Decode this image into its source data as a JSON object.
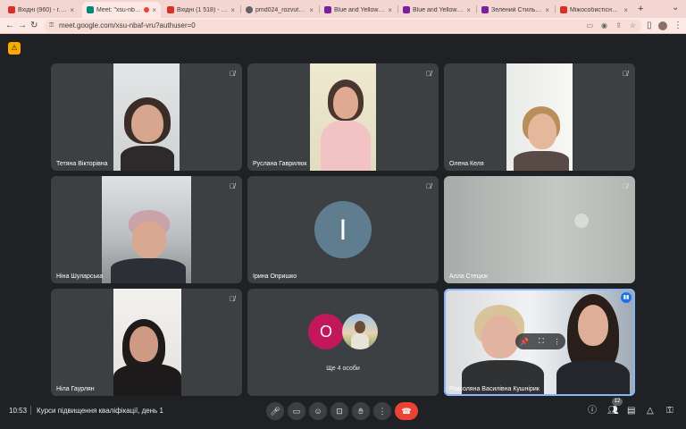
{
  "browser": {
    "tabs": [
      {
        "title": "Вхідні (960) - r.kus@",
        "favicon_color": "#d93025"
      },
      {
        "title": "Meet: \"xsu-nbaf-",
        "favicon_color": "#00897b",
        "active": true
      },
      {
        "title": "Вхідні (1 518) - rocon",
        "favicon_color": "#d93025"
      },
      {
        "title": "pmd024_rozvutok_m",
        "favicon_color": "#5f6368"
      },
      {
        "title": "Blue and Yellow Playf",
        "favicon_color": "#7b1fa2"
      },
      {
        "title": "Blue and Yellow Playf",
        "favicon_color": "#7b1fa2"
      },
      {
        "title": "Зелений Стильний",
        "favicon_color": "#7b1fa2"
      },
      {
        "title": "Міжособистісний ко",
        "favicon_color": "#d93025"
      }
    ],
    "url": "meet.google.com/xsu-nbaf-vru?authuser=0",
    "close_char": "×",
    "new_tab": "+"
  },
  "participants": [
    {
      "name": "Тетяна Вікторівна",
      "muted": true
    },
    {
      "name": "Руслана Гаврилюк",
      "muted": true
    },
    {
      "name": "Олена Келя",
      "muted": true
    },
    {
      "name": "Ніна Шуларська",
      "muted": true
    },
    {
      "name": "Ірина Опришко",
      "muted": true,
      "initial": "I"
    },
    {
      "name": "Алла Стецюк",
      "muted": true
    },
    {
      "name": "Ніла Гаурлян",
      "muted": true
    },
    {
      "name": "Роксоляна Василівна Кушнірик",
      "speaking": true
    }
  ],
  "others": {
    "label": "Ще 4 особи",
    "initial": "O"
  },
  "footer": {
    "time": "10:53",
    "meeting_title": "Курси підвищення кваліфікації, день 1",
    "people_count": "12"
  },
  "colors": {
    "accent": "#8ab4f8",
    "end_call": "#ea4335",
    "avatar_bg": "#5f7d8f",
    "others_avatar": "#c2185b"
  },
  "icons": {
    "muted_mic": "mic-off-icon",
    "mic": "mic-icon",
    "camera": "camera-icon",
    "emoji": "emoji-icon",
    "present": "present-screen-icon",
    "hand": "raise-hand-icon",
    "more": "more-vert-icon",
    "end": "call-end-icon"
  }
}
